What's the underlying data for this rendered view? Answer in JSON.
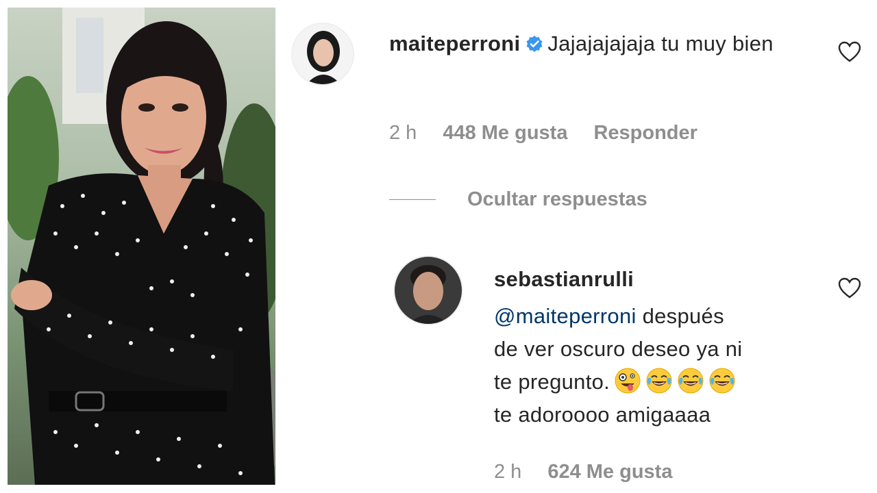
{
  "comment1": {
    "username": "maiteperroni",
    "verified_icon": "verified-badge-icon",
    "text": "Jajajajajaja tu muy bien",
    "time": "2 h",
    "likes": "448 Me gusta",
    "reply_label": "Responder"
  },
  "replies_toggle": {
    "label": "Ocultar respuestas"
  },
  "comment2": {
    "username": "sebastianrulli",
    "mention": "@maiteperroni",
    "text_line1": " después",
    "text_line2": "de ver oscuro deseo ya ni",
    "text_line3": "te pregunto.",
    "text_line4": "te adoroooo amigaaaa",
    "emojis": [
      "zany-face-emoji",
      "tears-of-joy-emoji",
      "tears-of-joy-emoji",
      "tears-of-joy-emoji"
    ],
    "time": "2 h",
    "likes": "624 Me gusta"
  },
  "colors": {
    "text": "#262626",
    "muted": "#8e8e8e",
    "mention": "#00376b",
    "verified": "#3897f0"
  }
}
